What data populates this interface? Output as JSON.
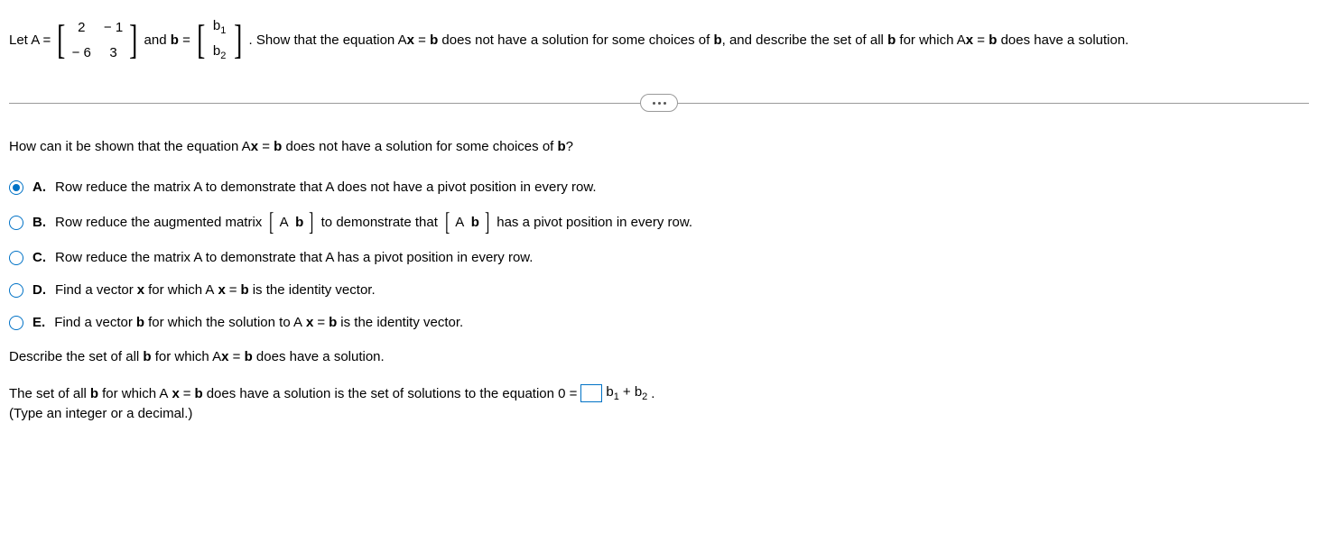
{
  "problem": {
    "letA": "Let A =",
    "matrixA": {
      "r1c1": "2",
      "r1c2": "− 1",
      "r2c1": "− 6",
      "r2c2": "3"
    },
    "andb": "and",
    "bEquals": "=",
    "vectorB": {
      "r1": "b",
      "r1sub": "1",
      "r2": "b",
      "r2sub": "2"
    },
    "tail": ". Show that the equation A",
    "tail2": " = ",
    "tail3": " does not have a solution for some choices of ",
    "tail4": ", and describe the set of all ",
    "tail5": " for which A",
    "tail6": " = ",
    "tail7": " does have a solution."
  },
  "question": {
    "prompt1": "How can it be shown that the equation A",
    "prompt2": " = ",
    "prompt3": " does not have a solution for some choices of ",
    "prompt4": "?"
  },
  "choices": {
    "A": {
      "letter": "A.",
      "text": "Row reduce the matrix A to demonstrate that A does not have a pivot position in every row."
    },
    "B": {
      "letter": "B.",
      "pre": "Row reduce the augmented matrix",
      "mid": "to demonstrate that",
      "post": "has a pivot position in every row.",
      "ab": "A  b"
    },
    "C": {
      "letter": "C.",
      "text": "Row reduce the matrix A to demonstrate that A has a pivot position in every row."
    },
    "D": {
      "letter": "D.",
      "pre": "Find a vector ",
      "mid": " for which A",
      "mid2": " = ",
      "post": " is the identity vector."
    },
    "E": {
      "letter": "E.",
      "pre": "Find a vector ",
      "mid": " for which the solution to A",
      "mid2": " = ",
      "post": " is the identity vector."
    }
  },
  "describe": {
    "line1a": "Describe the set of all ",
    "line1b": " for which A",
    "line1c": " = ",
    "line1d": " does have a solution."
  },
  "answer": {
    "pre": "The set of all ",
    "mid": " for which A",
    "mid2": " = ",
    "mid3": " does have a solution is the set of solutions to the equation 0 =",
    "b1": "b",
    "b1sub": "1",
    "plus": " + b",
    "b2sub": "2",
    "dot": "."
  },
  "hint": "(Type an integer or a decimal.)",
  "glyphs": {
    "x": "x",
    "b": "b"
  }
}
